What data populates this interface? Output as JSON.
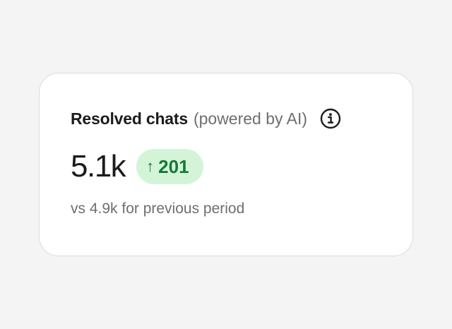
{
  "metric": {
    "title": "Resolved chats",
    "subtitle": "(powered by AI)",
    "info_icon": "info-icon",
    "value": "5.1k",
    "delta": {
      "arrow": "↑",
      "value": "201",
      "direction": "up",
      "text_color": "#137a34",
      "background": "#d4f4d8"
    },
    "comparison": "vs 4.9k for previous period"
  }
}
